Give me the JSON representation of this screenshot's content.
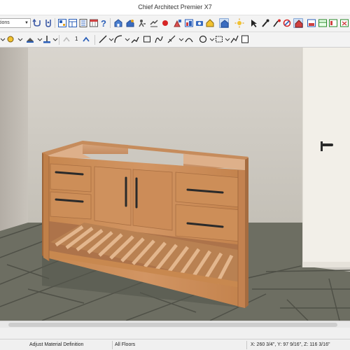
{
  "window": {
    "title": "Chief Architect Premier X7"
  },
  "toolbar": {
    "layer_select_value": "tions",
    "line_weight_value": "1"
  },
  "icons": {
    "top_row": [
      "undo-icon",
      "help-icon",
      "plan-view-icon",
      "layout-icon",
      "material-list-icon",
      "schedule-icon",
      "help-question-icon",
      "camera-icon",
      "overview-icon",
      "pan-icon",
      "eye-icon",
      "color-icon",
      "paint-icon",
      "render-icon",
      "camera-2-icon",
      "home-icon",
      "camera-view-icon",
      "sun-icon",
      "select-icon",
      "dropper-icon",
      "paint-bucket-icon",
      "material-icon",
      "window-icon",
      "wall-icon",
      "close-icon"
    ],
    "second_row": [
      "arrow-icon",
      "pen-icon",
      "layer-icon",
      "text-icon",
      "line-icon",
      "arc-icon",
      "box-icon",
      "edit-icon",
      "curve-icon",
      "circle-icon",
      "polygon-icon",
      "dimension-icon"
    ]
  },
  "colors": {
    "red_dot": "#d62424",
    "blue_accent": "#2b5fb8",
    "wall": "#ccc9c1",
    "floor": "#6d6e62",
    "cabinet": "#c98a55"
  },
  "statusbar": {
    "message": "Adjust Material Definition",
    "floor": "All Floors",
    "coordinates": "X: 260 3/4\", Y: 97 9/16\", Z: 116 3/16\""
  }
}
